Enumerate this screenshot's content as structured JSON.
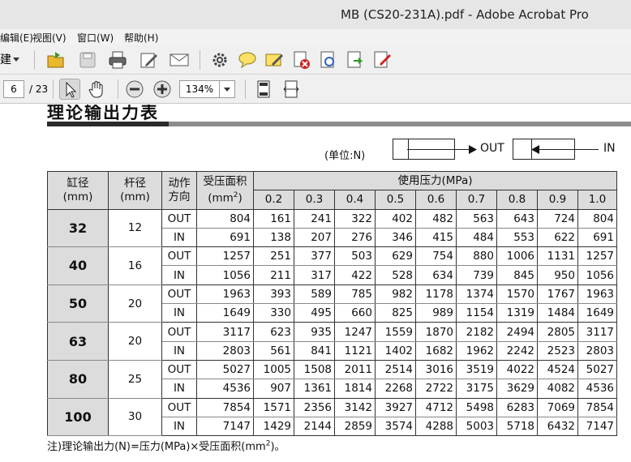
{
  "window": {
    "title": "MB (CS20-231A).pdf - Adobe Acrobat Pro"
  },
  "menu": {
    "items": [
      "编辑(E)",
      "视图(V)",
      "窗口(W)",
      "帮助(H)"
    ]
  },
  "toolbar": {
    "cut_label": "建",
    "icons": [
      "open-icon",
      "save-icon",
      "print-icon",
      "edit-icon",
      "email-icon",
      "settings-icon",
      "comment-icon",
      "sign-icon",
      "secure-icon",
      "attach-icon",
      "export-icon",
      "forms-icon"
    ]
  },
  "nav": {
    "current_page": "6",
    "total_pages": "/ 23",
    "zoom": "134%"
  },
  "document": {
    "title": "理论输出力表",
    "unit": "(单位:N)",
    "out_label": "OUT",
    "in_label": "IN",
    "headers": {
      "bore": "缸径",
      "bore_unit": "(mm)",
      "rod": "杆径",
      "rod_unit": "(mm)",
      "direction": "动作",
      "direction2": "方向",
      "area": "受压面积",
      "area_unit": "(mm",
      "area_sup": "2",
      "area_close": ")",
      "pressure": "使用压力(MPa)",
      "pressures": [
        "0.2",
        "0.3",
        "0.4",
        "0.5",
        "0.6",
        "0.7",
        "0.8",
        "0.9",
        "1.0"
      ]
    },
    "rows": [
      {
        "bore": "32",
        "rod": "12",
        "out": {
          "dir": "OUT",
          "area": "804",
          "values": [
            "161",
            "241",
            "322",
            "402",
            "482",
            "563",
            "643",
            "724",
            "804"
          ]
        },
        "in": {
          "dir": "IN",
          "area": "691",
          "values": [
            "138",
            "207",
            "276",
            "346",
            "415",
            "484",
            "553",
            "622",
            "691"
          ]
        }
      },
      {
        "bore": "40",
        "rod": "16",
        "out": {
          "dir": "OUT",
          "area": "1257",
          "values": [
            "251",
            "377",
            "503",
            "629",
            "754",
            "880",
            "1006",
            "1131",
            "1257"
          ]
        },
        "in": {
          "dir": "IN",
          "area": "1056",
          "values": [
            "211",
            "317",
            "422",
            "528",
            "634",
            "739",
            "845",
            "950",
            "1056"
          ]
        }
      },
      {
        "bore": "50",
        "rod": "20",
        "out": {
          "dir": "OUT",
          "area": "1963",
          "values": [
            "393",
            "589",
            "785",
            "982",
            "1178",
            "1374",
            "1570",
            "1767",
            "1963"
          ]
        },
        "in": {
          "dir": "IN",
          "area": "1649",
          "values": [
            "330",
            "495",
            "660",
            "825",
            "989",
            "1154",
            "1319",
            "1484",
            "1649"
          ]
        }
      },
      {
        "bore": "63",
        "rod": "20",
        "out": {
          "dir": "OUT",
          "area": "3117",
          "values": [
            "623",
            "935",
            "1247",
            "1559",
            "1870",
            "2182",
            "2494",
            "2805",
            "3117"
          ]
        },
        "in": {
          "dir": "IN",
          "area": "2803",
          "values": [
            "561",
            "841",
            "1121",
            "1402",
            "1682",
            "1962",
            "2242",
            "2523",
            "2803"
          ]
        }
      },
      {
        "bore": "80",
        "rod": "25",
        "out": {
          "dir": "OUT",
          "area": "5027",
          "values": [
            "1005",
            "1508",
            "2011",
            "2514",
            "3016",
            "3519",
            "4022",
            "4524",
            "5027"
          ]
        },
        "in": {
          "dir": "IN",
          "area": "4536",
          "values": [
            "907",
            "1361",
            "1814",
            "2268",
            "2722",
            "3175",
            "3629",
            "4082",
            "4536"
          ]
        }
      },
      {
        "bore": "100",
        "rod": "30",
        "out": {
          "dir": "OUT",
          "area": "7854",
          "values": [
            "1571",
            "2356",
            "3142",
            "3927",
            "4712",
            "5498",
            "6283",
            "7069",
            "7854"
          ]
        },
        "in": {
          "dir": "IN",
          "area": "7147",
          "values": [
            "1429",
            "2144",
            "2859",
            "3574",
            "4288",
            "5003",
            "5718",
            "6432",
            "7147"
          ]
        }
      }
    ],
    "note_prefix": "注)理论输出力(N)=压力(MPa)×受压面积(mm",
    "note_sup": "2",
    "note_suffix": ")。"
  }
}
